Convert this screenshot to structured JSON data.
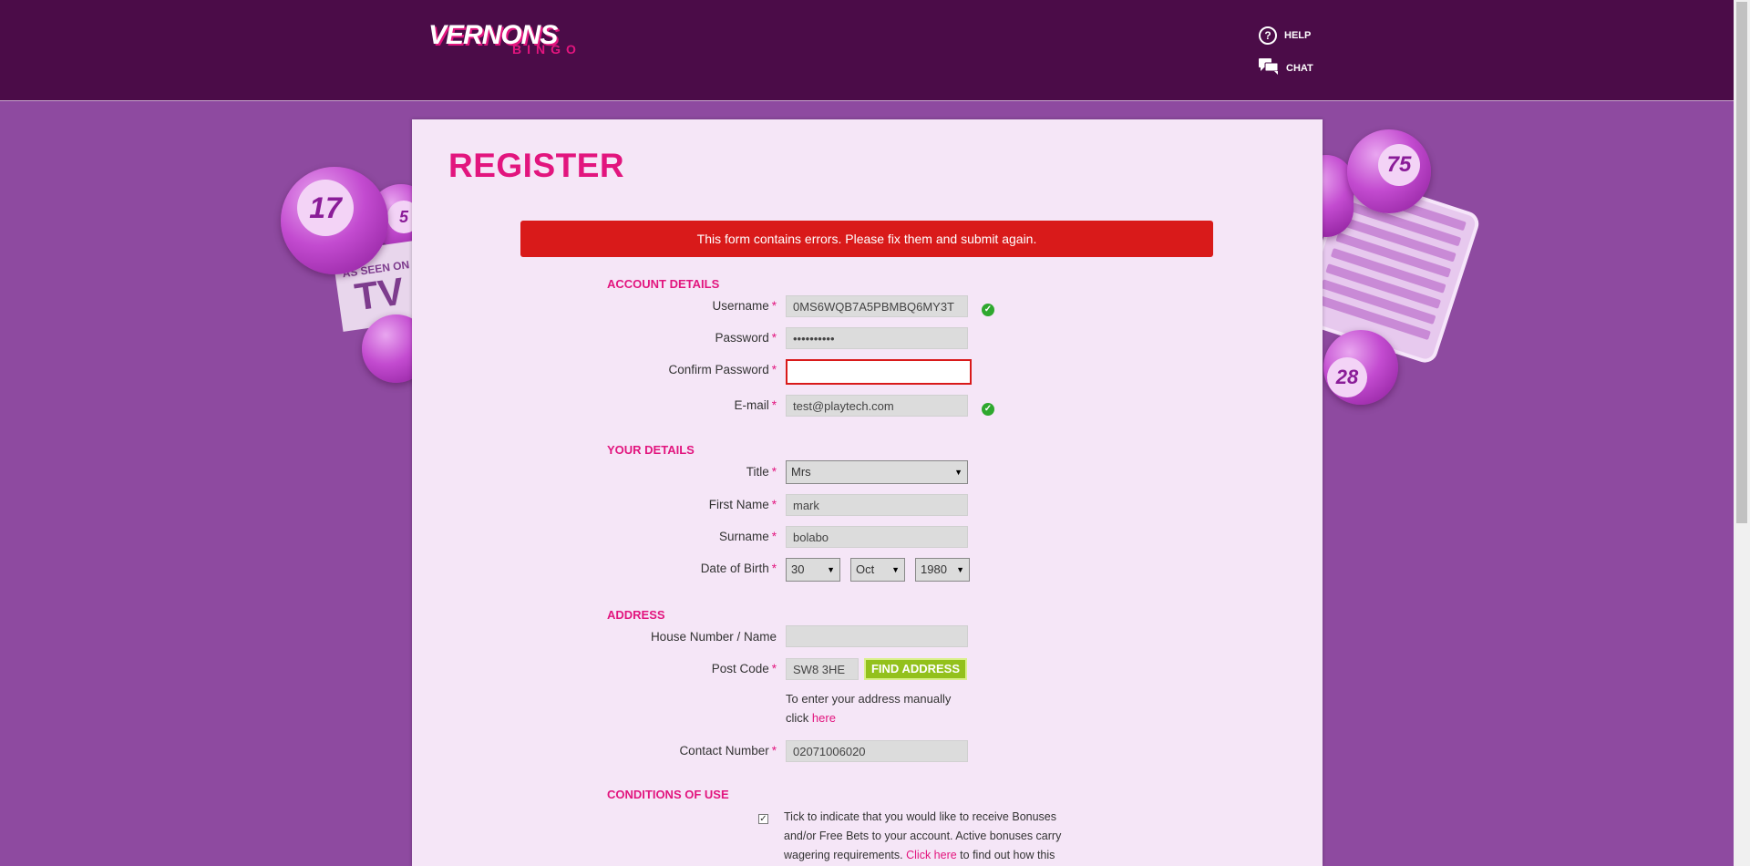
{
  "header": {
    "logo_main": "VERNONS",
    "logo_sub": "BINGO",
    "help_label": "HELP",
    "chat_label": "CHAT"
  },
  "decor": {
    "balls": [
      "17",
      "75",
      "28",
      "5"
    ],
    "tv_card_top": "AS SEEN ON",
    "tv_card_main": "TV"
  },
  "page": {
    "title": "REGISTER",
    "error_message": "This form contains errors. Please fix them and submit again."
  },
  "sections": {
    "account": "ACCOUNT DETAILS",
    "your_details": "YOUR DETAILS",
    "address": "ADDRESS",
    "conditions": "CONDITIONS OF USE"
  },
  "required_marker": "*",
  "account": {
    "username_label": "Username",
    "username_value": "0MS6WQB7A5PBMBQ6MY3T",
    "password_label": "Password",
    "password_value": "••••••••••",
    "confirm_label": "Confirm Password",
    "confirm_value": "",
    "email_label": "E-mail",
    "email_value": "test@playtech.com"
  },
  "details": {
    "title_label": "Title",
    "title_value": "Mrs",
    "first_name_label": "First Name",
    "first_name_value": "mark",
    "surname_label": "Surname",
    "surname_value": "bolabo",
    "dob_label": "Date of Birth",
    "dob_day": "30",
    "dob_month": "Oct",
    "dob_year": "1980"
  },
  "address": {
    "house_label": "House Number / Name",
    "house_value": "",
    "postcode_label": "Post Code",
    "postcode_value": "SW8 3HE",
    "find_button": "FIND ADDRESS",
    "manual_text": "To enter your address manually click",
    "manual_link": "here",
    "contact_label": "Contact Number",
    "contact_value": "02071006020"
  },
  "conditions": {
    "bonus_checked": true,
    "bonus_text_1": "Tick to indicate that you would like to receive Bonuses and/or Free Bets to your account. Active bonuses carry wagering requirements.",
    "bonus_link": "Click here",
    "bonus_text_2": "to find out how this"
  },
  "colors": {
    "header_bg": "#4b0c48",
    "page_bg": "#8e4aa0",
    "panel_bg": "#f5e6f7",
    "accent_pink": "#e2157e",
    "error_red": "#d91a1a",
    "button_green": "#93c11c",
    "check_green": "#2ea82e"
  }
}
